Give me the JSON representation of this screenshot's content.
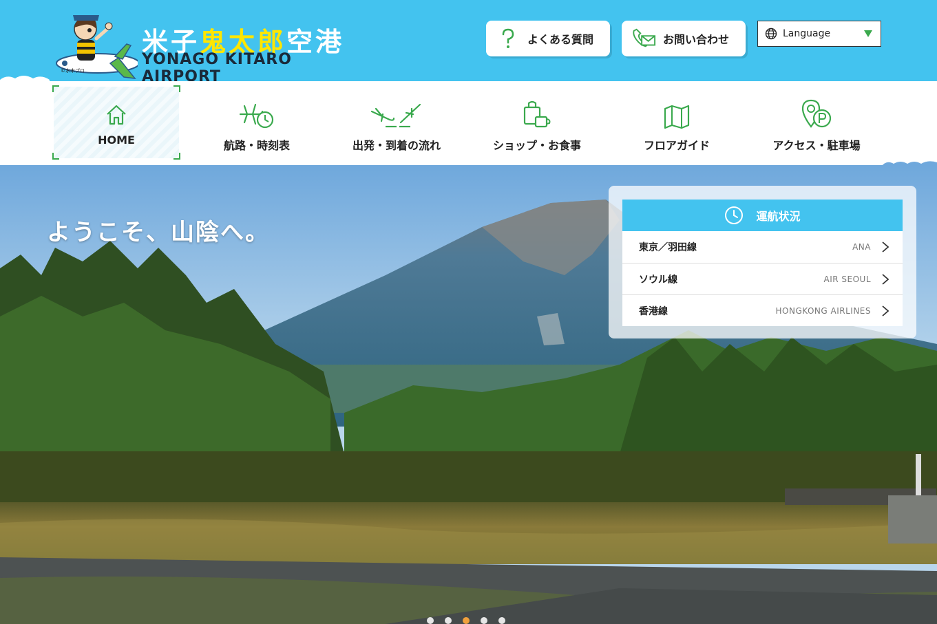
{
  "logo": {
    "jp_part1": "米子",
    "jp_part2": "鬼太郎",
    "jp_part3": "空港",
    "en": "YONAGO KITARO AIRPORT",
    "copyright": "©水木プロ"
  },
  "header": {
    "faq_label": "よくある質問",
    "contact_label": "お問い合わせ",
    "language_label": "Language"
  },
  "nav": {
    "items": [
      {
        "label": "HOME",
        "icon": "home-icon"
      },
      {
        "label": "航路・時刻表",
        "icon": "plane-clock-icon"
      },
      {
        "label": "出発・到着の流れ",
        "icon": "departure-arrival-icon"
      },
      {
        "label": "ショップ・お食事",
        "icon": "shop-icon"
      },
      {
        "label": "フロアガイド",
        "icon": "map-icon"
      },
      {
        "label": "アクセス・駐車場",
        "icon": "parking-location-icon"
      }
    ]
  },
  "hero": {
    "welcome": "ようこそ、山陰へ。"
  },
  "status": {
    "title": "運航状況",
    "routes": [
      {
        "name": "東京／羽田線",
        "airline": "ANA"
      },
      {
        "name": "ソウル線",
        "airline": "AIR SEOUL"
      },
      {
        "name": "香港線",
        "airline": "HONGKONG AIRLINES"
      }
    ]
  },
  "carousel": {
    "count": 5,
    "active": 3
  },
  "colors": {
    "header_blue": "#43c3ef",
    "accent_green": "#3aa94d",
    "logo_yellow": "#ffe600",
    "active_dot": "#f0a03c"
  }
}
